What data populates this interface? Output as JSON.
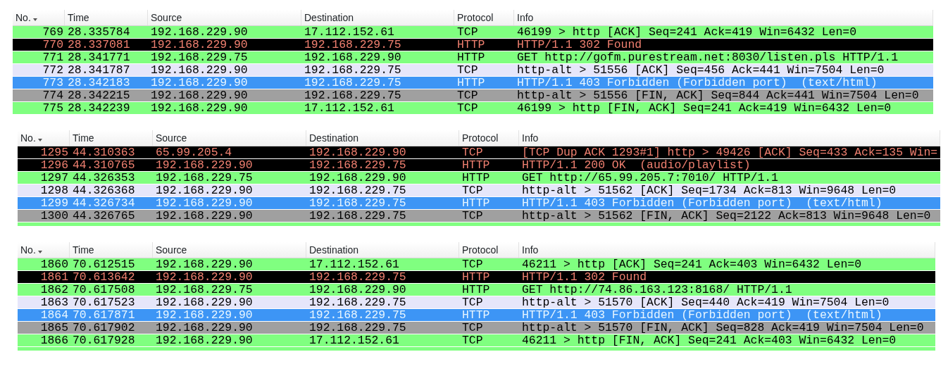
{
  "panels": [
    {
      "columns": [
        {
          "label": "No.",
          "sorted": true
        },
        {
          "label": "Time",
          "sorted": false
        },
        {
          "label": "Source",
          "sorted": false
        },
        {
          "label": "Destination",
          "sorted": false
        },
        {
          "label": "Protocol",
          "sorted": false
        },
        {
          "label": "Info",
          "sorted": false
        }
      ],
      "rows": [
        {
          "no": "769",
          "time": "28.335784",
          "source": "192.168.229.90",
          "destination": "17.112.152.61",
          "protocol": "TCP",
          "info": "46199 > http [ACK] Seq=241 Ack=419 Win=6432 Len=0",
          "color": "#80ff80"
        },
        {
          "no": "770",
          "time": "28.337081",
          "source": "192.168.229.90",
          "destination": "192.168.229.75",
          "protocol": "HTTP",
          "info": "HTTP/1.1 302 Found",
          "color": "#000000"
        },
        {
          "no": "771",
          "time": "28.341771",
          "source": "192.168.229.75",
          "destination": "192.168.229.90",
          "protocol": "HTTP",
          "info": "GET http://gofm.purestream.net:8030/listen.pls HTTP/1.1",
          "color": "#80ff80"
        },
        {
          "no": "772",
          "time": "28.341787",
          "source": "192.168.229.90",
          "destination": "192.168.229.75",
          "protocol": "TCP",
          "info": "http-alt > 51556 [ACK] Seq=456 Ack=441 Win=7504 Len=0",
          "color": "#e6e6fa"
        },
        {
          "no": "773",
          "time": "28.342183",
          "source": "192.168.229.90",
          "destination": "192.168.229.75",
          "protocol": "HTTP",
          "info": "HTTP/1.1 403 Forbidden (Forbidden port)  (text/html)",
          "color": "#3d95f5"
        },
        {
          "no": "774",
          "time": "28.342215",
          "source": "192.168.229.90",
          "destination": "192.168.229.75",
          "protocol": "TCP",
          "info": "http-alt > 51556 [FIN, ACK] Seq=844 Ack=441 Win=7504 Len=0",
          "color": "#a0a0a0"
        },
        {
          "no": "775",
          "time": "28.342239",
          "source": "192.168.229.90",
          "destination": "17.112.152.61",
          "protocol": "TCP",
          "info": "46199 > http [FIN, ACK] Seq=241 Ack=419 Win=6432 Len=0",
          "color": "#80ff80"
        }
      ]
    },
    {
      "columns": [
        {
          "label": "No.",
          "sorted": true
        },
        {
          "label": "Time",
          "sorted": false
        },
        {
          "label": "Source",
          "sorted": false
        },
        {
          "label": "Destination",
          "sorted": false
        },
        {
          "label": "Protocol",
          "sorted": false
        },
        {
          "label": "Info",
          "sorted": false
        }
      ],
      "rows": [
        {
          "no": "1295",
          "time": "44.310363",
          "source": "65.99.205.4",
          "destination": "192.168.229.90",
          "protocol": "TCP",
          "info": "[TCP Dup ACK 1293#1] http > 49426 [ACK] Seq=433 Ack=135 Win=",
          "color": "#000000"
        },
        {
          "no": "1296",
          "time": "44.310765",
          "source": "192.168.229.90",
          "destination": "192.168.229.75",
          "protocol": "HTTP",
          "info": "HTTP/1.1 200 OK  (audio/playlist)",
          "color": "#000000"
        },
        {
          "no": "1297",
          "time": "44.326353",
          "source": "192.168.229.75",
          "destination": "192.168.229.90",
          "protocol": "HTTP",
          "info": "GET http://65.99.205.7:7010/ HTTP/1.1",
          "color": "#80ff80"
        },
        {
          "no": "1298",
          "time": "44.326368",
          "source": "192.168.229.90",
          "destination": "192.168.229.75",
          "protocol": "TCP",
          "info": "http-alt > 51562 [ACK] Seq=1734 Ack=813 Win=9648 Len=0",
          "color": "#e6e6fa"
        },
        {
          "no": "1299",
          "time": "44.326734",
          "source": "192.168.229.90",
          "destination": "192.168.229.75",
          "protocol": "HTTP",
          "info": "HTTP/1.1 403 Forbidden (Forbidden port)  (text/html)",
          "color": "#3d95f5"
        },
        {
          "no": "1300",
          "time": "44.326765",
          "source": "192.168.229.90",
          "destination": "192.168.229.75",
          "protocol": "TCP",
          "info": "http-alt > 51562 [FIN, ACK] Seq=2122 Ack=813 Win=9648 Len=0",
          "color": "#a0a0a0"
        },
        {
          "color": "#80ff80"
        }
      ]
    },
    {
      "columns": [
        {
          "label": "No.",
          "sorted": true
        },
        {
          "label": "Time",
          "sorted": false
        },
        {
          "label": "Source",
          "sorted": false
        },
        {
          "label": "Destination",
          "sorted": false
        },
        {
          "label": "Protocol",
          "sorted": false
        },
        {
          "label": "Info",
          "sorted": false
        }
      ],
      "rows": [
        {
          "no": "1860",
          "time": "70.612515",
          "source": "192.168.229.90",
          "destination": "17.112.152.61",
          "protocol": "TCP",
          "info": "46211 > http [ACK] Seq=241 Ack=403 Win=6432 Len=0",
          "color": "#80ff80"
        },
        {
          "no": "1861",
          "time": "70.613642",
          "source": "192.168.229.90",
          "destination": "192.168.229.75",
          "protocol": "HTTP",
          "info": "HTTP/1.1 302 Found",
          "color": "#000000"
        },
        {
          "no": "1862",
          "time": "70.617508",
          "source": "192.168.229.75",
          "destination": "192.168.229.90",
          "protocol": "HTTP",
          "info": "GET http://74.86.163.123:8168/ HTTP/1.1",
          "color": "#80ff80"
        },
        {
          "no": "1863",
          "time": "70.617523",
          "source": "192.168.229.90",
          "destination": "192.168.229.75",
          "protocol": "TCP",
          "info": "http-alt > 51570 [ACK] Seq=440 Ack=419 Win=7504 Len=0",
          "color": "#e6e6fa"
        },
        {
          "no": "1864",
          "time": "70.617871",
          "source": "192.168.229.90",
          "destination": "192.168.229.75",
          "protocol": "HTTP",
          "info": "HTTP/1.1 403 Forbidden (Forbidden port)  (text/html)",
          "color": "#3d95f5"
        },
        {
          "no": "1865",
          "time": "70.617902",
          "source": "192.168.229.90",
          "destination": "192.168.229.75",
          "protocol": "TCP",
          "info": "http-alt > 51570 [FIN, ACK] Seq=828 Ack=419 Win=7504 Len=0",
          "color": "#a0a0a0"
        },
        {
          "no": "1866",
          "time": "70.617928",
          "source": "192.168.229.90",
          "destination": "17.112.152.61",
          "protocol": "TCP",
          "info": "46211 > http [FIN, ACK] Seq=241 Ack=403 Win=6432 Len=0",
          "color": "#80ff80"
        },
        {
          "color": "#80ff80"
        }
      ]
    }
  ]
}
